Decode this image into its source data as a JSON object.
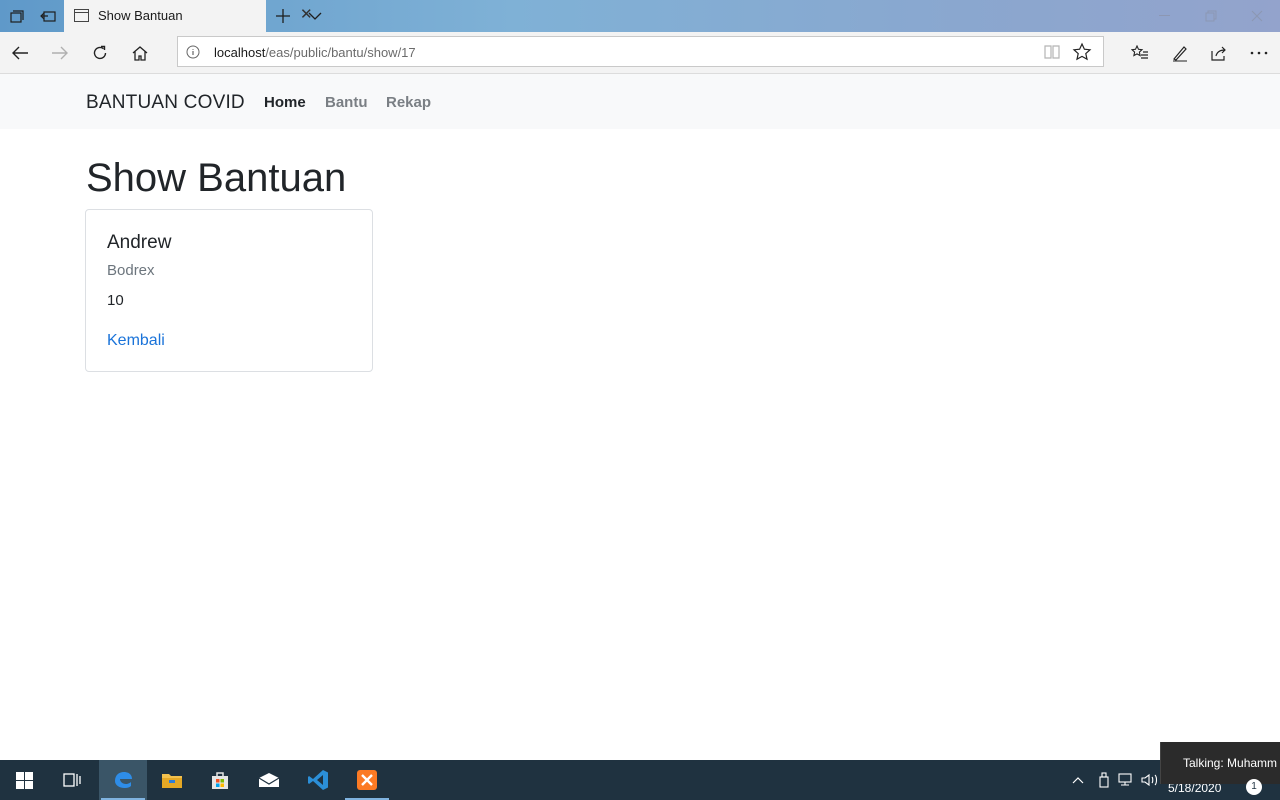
{
  "browser": {
    "tab_title": "Show Bantuan",
    "url_host": "localhost",
    "url_path": "/eas/public/bantu/show/17"
  },
  "site": {
    "brand": "BANTUAN COVID",
    "nav": {
      "home": "Home",
      "bantu": "Bantu",
      "rekap": "Rekap"
    }
  },
  "main": {
    "page_title": "Show Bantuan",
    "card": {
      "name": "Andrew",
      "item": "Bodrex",
      "quantity": "10",
      "back_link": "Kembali"
    }
  },
  "taskbar": {
    "clock_date": "5/18/2020",
    "notification_count": "1",
    "toast_text": "Talking: Muhamm"
  },
  "colors": {
    "link": "#1a73d9",
    "navbar_bg": "#f8f9fa",
    "taskbar_bg": "#1f3240"
  }
}
